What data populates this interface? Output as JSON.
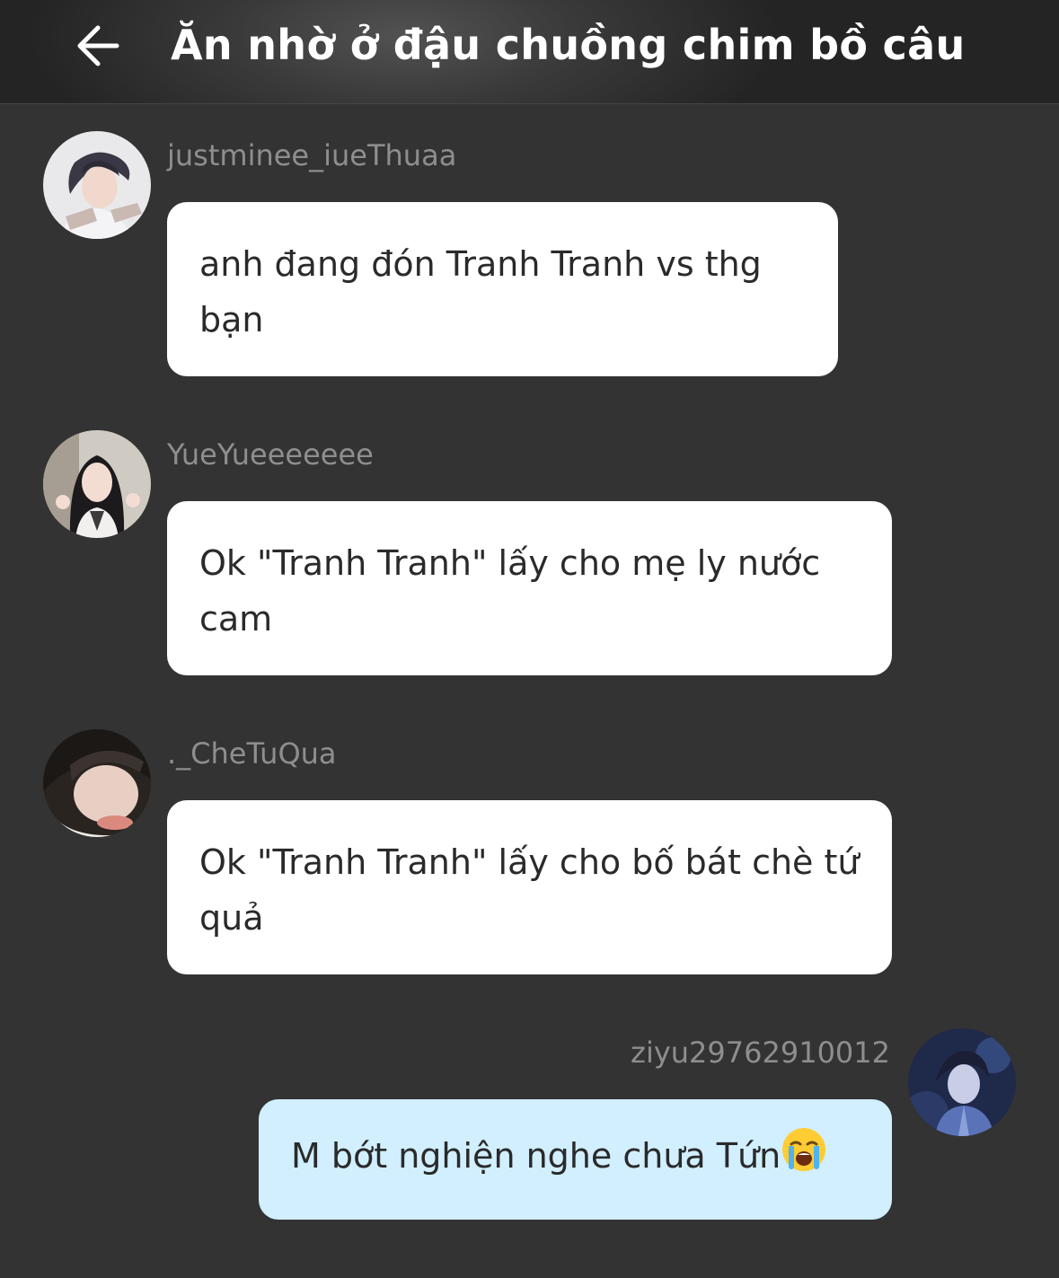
{
  "header": {
    "title": "Ăn nhờ ở đậu chuồng chim bồ câu",
    "back_icon": "arrow-left-icon"
  },
  "colors": {
    "background": "#333333",
    "bubble_other": "#ffffff",
    "bubble_mine": "#d1efff",
    "username": "#8e8e8e",
    "text": "#2a2a2a"
  },
  "messages": [
    {
      "username": "justminee_iueThuaa",
      "text": "anh đang đón Tranh Tranh vs thg bạn",
      "side": "left"
    },
    {
      "username": "YueYueeeeeee",
      "text": "Ok \"Tranh Tranh\" lấy cho mẹ ly nước cam",
      "side": "left"
    },
    {
      "username": "._CheTuQua",
      "text": "Ok \"Tranh Tranh\" lấy cho bố bát chè tứ quả",
      "side": "left"
    },
    {
      "username": "ziyu29762910012",
      "text": "M bớt nghiện nghe chưa Tứn",
      "emoji": "loudly-crying-face-emoji",
      "side": "right"
    }
  ]
}
